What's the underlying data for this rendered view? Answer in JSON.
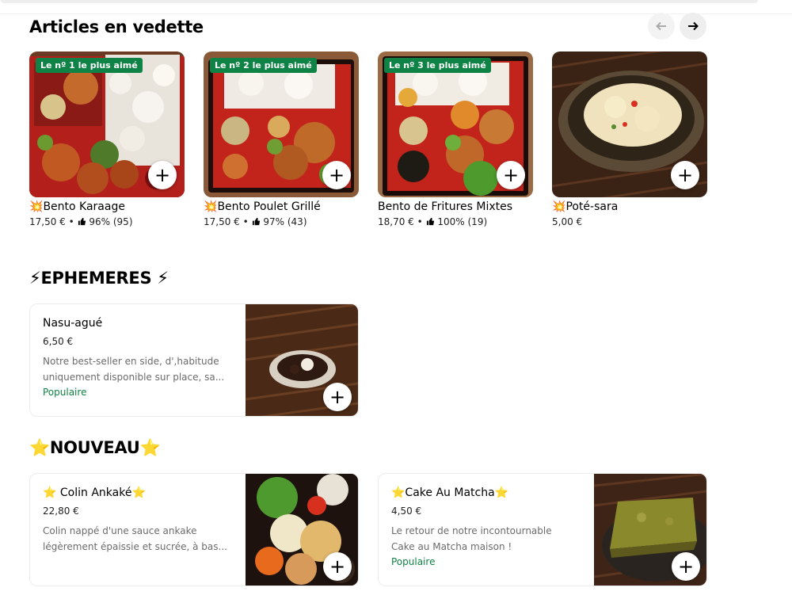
{
  "featured": {
    "title": "Articles en vedette",
    "items": [
      {
        "badge": "Le nº 1 le plus aimé",
        "emoji": "💥",
        "name": "Bento Karaage",
        "price": "17,50 €",
        "rating": "96% (95)"
      },
      {
        "badge": "Le nº 2 le plus aimé",
        "emoji": "💥",
        "name": "Bento Poulet Grillé",
        "price": "17,50 €",
        "rating": "97% (43)"
      },
      {
        "badge": "Le nº 3 le plus aimé",
        "emoji": "",
        "name": "Bento de Fritures Mixtes",
        "price": "18,70 €",
        "rating": "100% (19)"
      },
      {
        "badge": "",
        "emoji": "💥",
        "name": "Poté-sara",
        "price": "5,00 €",
        "rating": ""
      }
    ],
    "sep": "•"
  },
  "ephemeres": {
    "title": "⚡EPHEMERES ⚡",
    "items": [
      {
        "name": "Nasu-agué",
        "price": "6,50 €",
        "desc1": "Notre best-seller en side, d',habitude",
        "desc2": "uniquement disponible sur place, sa...",
        "tag": "Populaire"
      }
    ]
  },
  "nouveau": {
    "title": "⭐NOUVEAU⭐",
    "items": [
      {
        "name": "⭐ Colin Ankaké⭐",
        "price": "22,80 €",
        "desc1": "Colin nappé d'une sauce ankake",
        "desc2": "légèrement épaissie et sucrée, à bas...",
        "tag": ""
      },
      {
        "name": "⭐Cake Au Matcha⭐",
        "price": "4,50 €",
        "desc1": "Le retour de notre incontournable",
        "desc2": "Cake au Matcha maison !",
        "tag": "Populaire"
      }
    ]
  },
  "controls": {
    "add": "+",
    "prev_icon": "arrow-left-icon",
    "next_icon": "arrow-right-icon"
  },
  "colors": {
    "accent_green": "#0e8345",
    "text": "#000000",
    "muted": "#6b6b6b"
  }
}
